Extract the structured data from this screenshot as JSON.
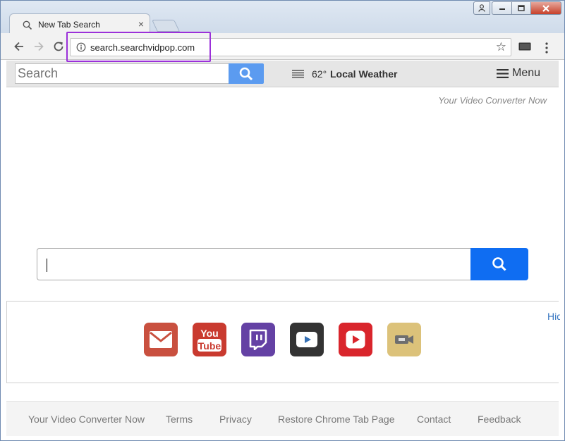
{
  "tab": {
    "title": "New Tab Search",
    "close": "×"
  },
  "omnibox": {
    "url": "search.searchvidpop.com",
    "star": "☆"
  },
  "ext_bar": {
    "search_placeholder": "Search",
    "weather_temp": "62°",
    "weather_label": "Local Weather",
    "menu_label": "Menu"
  },
  "page": {
    "tagline": "Your Video Converter Now",
    "hide_link": "Hide"
  },
  "shortcuts": [
    {
      "name": "gmail",
      "icon": "mail-icon",
      "color": "#c9503f"
    },
    {
      "name": "youtube-logo",
      "icon": "youtube-logo-icon",
      "color": "#c93a2f"
    },
    {
      "name": "twitch",
      "icon": "twitch-icon",
      "color": "#6441a4"
    },
    {
      "name": "video-player",
      "icon": "play-dark-icon",
      "color": "#333333"
    },
    {
      "name": "youtube",
      "icon": "play-red-icon",
      "color": "#d9252c"
    },
    {
      "name": "video-camera",
      "icon": "camera-icon",
      "color": "#dcc27a"
    }
  ],
  "footer": {
    "links": [
      "Your Video Converter Now",
      "Terms",
      "Privacy",
      "Restore Chrome Tab Page",
      "Contact",
      "Feedback"
    ]
  },
  "colors": {
    "accent": "#0f6df2",
    "highlight": "#9b30d9"
  }
}
